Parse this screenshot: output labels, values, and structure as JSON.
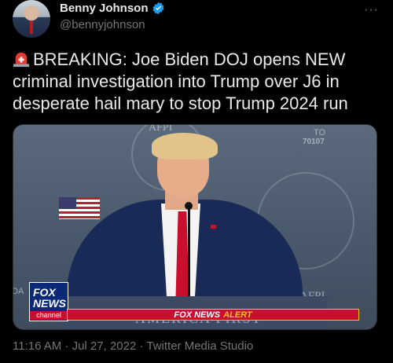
{
  "author": {
    "display_name": "Benny Johnson",
    "handle": "@bennyjohnson",
    "verified": true
  },
  "tweet": {
    "siren_icon": "rotating-light-emoji",
    "text": "BREAKING: Joe Biden DOJ opens NEW criminal investigation into Trump over J6 in desperate hail mary to stop Trump 2024 run"
  },
  "media": {
    "fox_logo": {
      "line1": "FOX",
      "line2": "NEWS",
      "line3": "channel"
    },
    "alert_bar": {
      "prefix": "FOX NEWS",
      "suffix": "ALERT"
    },
    "background_text": {
      "top": "AFPI",
      "right_top": "TO",
      "right_num": "70107",
      "right_bottom": "AFPI",
      "left_mid": "DA",
      "podium": "AMERICA FIRST"
    }
  },
  "meta": {
    "timestamp": "11:16 AM · Jul 27, 2022 · Twitter Media Studio"
  },
  "colors": {
    "background": "#000000",
    "text_primary": "#e7e9ea",
    "text_secondary": "#71767b",
    "verified_blue": "#1d9bf0",
    "fox_red": "#c8102e",
    "fox_blue": "#0a2a78",
    "alert_yellow": "#f5c518"
  }
}
